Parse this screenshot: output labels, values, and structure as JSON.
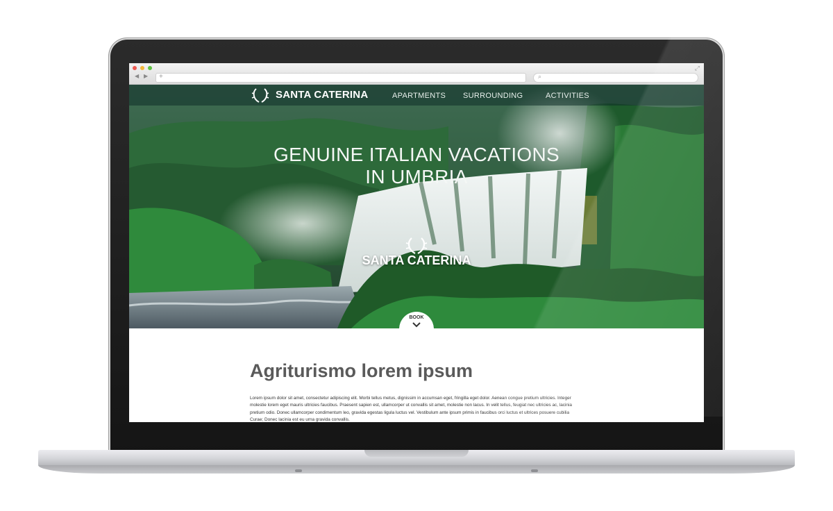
{
  "browser": {
    "controls": [
      "close",
      "minimize",
      "zoom"
    ],
    "back_icon": "back-arrow-icon",
    "forward_icon": "forward-arrow-icon",
    "new_tab_glyph": "+",
    "search_glyph": "🔍",
    "expand_glyph": "⤢"
  },
  "site": {
    "brand_name": "SANTA CATERINA",
    "nav": [
      {
        "label": "APARTMENTS"
      },
      {
        "label": "SURROUNDING"
      },
      {
        "label": "ACTIVITIES"
      }
    ]
  },
  "hero": {
    "headline_line1": "GENUINE ITALIAN VACATIONS",
    "headline_line2": "IN UMBRIA",
    "center_brand": "SANTA CATERINA",
    "book_label": "BOOK"
  },
  "content": {
    "title": "Agriturismo lorem ipsum",
    "body": "Lorem ipsum dolor sit amet, consectetur adipiscing elit. Morbi tellus metus, dignissim in accumsan eget, fringilla eget dolor. Aenean congue pretium ultricies. Integer molestie lorem eget mauris ultricies faucibus. Praesent sapien est, ullamcorper ut convallis sit amet, molestie non lacus. In velit tellus, feugiat nec ultricies ac, lacinia pretium odio. Donec ullamcorper condimentum leo, gravida egestas ligula luctus vel. Vestibulum ante ipsum primis in faucibus orci luctus et ultrices posuere cubilia Curae; Donec lacinia est eu urna gravida convallis."
  },
  "colors": {
    "nav_overlay": "#0f2d28",
    "title_gray": "#5a5a5a",
    "foliage_dark": "#1f4a2c",
    "foliage_bright": "#2e8a3c",
    "water_white": "#eef3f2",
    "laptop_bezel": "#1a1a1a",
    "laptop_base": "#d5d6da"
  }
}
